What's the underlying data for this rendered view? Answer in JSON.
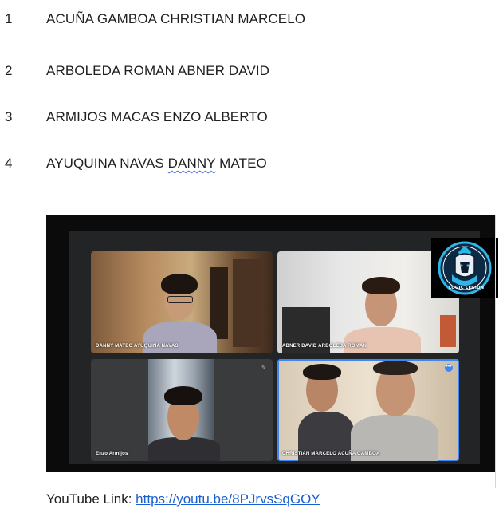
{
  "students": [
    {
      "number": "1",
      "name": "ACUÑA GAMBOA CHRISTIAN MARCELO"
    },
    {
      "number": "2",
      "name": "ARBOLEDA ROMAN ABNER DAVID"
    },
    {
      "number": "3",
      "name": "ARMIJOS MACAS ENZO ALBERTO"
    },
    {
      "number": "4",
      "name_before": "AYUQUINA NAVAS ",
      "name_flagged": "DANNY",
      "name_after": " MATEO"
    }
  ],
  "video_call": {
    "participants": [
      {
        "label": "DANNY MATEO AYUQUINA NAVAS"
      },
      {
        "label": "ABNER DAVID ARBOLEDA ROMAN"
      },
      {
        "label": "Enzo Armijos"
      },
      {
        "label": "CHRISTIAN MARCELO ACUÑA GAMBOA"
      }
    ],
    "logo_text": "LOGIC LEGION",
    "accent_color": "#3f86f5"
  },
  "youtube": {
    "label": "YouTube Link: ",
    "url_text": "https://youtu.be/8PJrvsSqGOY"
  }
}
